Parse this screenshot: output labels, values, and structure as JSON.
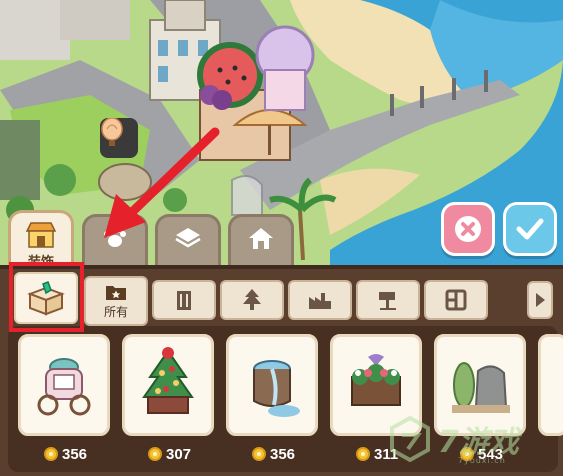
{
  "category_tabs": [
    {
      "label": "装饰",
      "icon": "shop-icon",
      "active": true
    },
    {
      "label": "",
      "icon": "pawprint-icon",
      "active": false
    },
    {
      "label": "",
      "icon": "stack-icon",
      "active": false
    },
    {
      "label": "",
      "icon": "house-icon",
      "active": false
    }
  ],
  "sub_tabs": [
    {
      "label": "",
      "icon": "gift-box-icon",
      "active": true
    },
    {
      "label": "所有",
      "icon": "star-folder-icon",
      "active": false
    },
    {
      "label": "",
      "icon": "building-icon",
      "active": false
    },
    {
      "label": "",
      "icon": "tree-icon",
      "active": false
    },
    {
      "label": "",
      "icon": "factory-icon",
      "active": false
    },
    {
      "label": "",
      "icon": "lamp-icon",
      "active": false
    },
    {
      "label": "",
      "icon": "grid-tile-icon",
      "active": false
    }
  ],
  "items": [
    {
      "name": "ornate carriage",
      "icon": "carriage-icon",
      "price": "356"
    },
    {
      "name": "decorated christmas tree",
      "icon": "christmas-tree-icon",
      "price": "307"
    },
    {
      "name": "stone fountain",
      "icon": "fountain-icon",
      "price": "356"
    },
    {
      "name": "flower planter",
      "icon": "flower-planter-icon",
      "price": "311"
    },
    {
      "name": "hedge rock garden",
      "icon": "hedge-rock-icon",
      "price": "543"
    }
  ],
  "actions": {
    "cancel_icon": "close-icon",
    "confirm_icon": "check-icon"
  },
  "watermark": {
    "text": "7游戏",
    "url": "7youxi.cn"
  },
  "colors": {
    "panel": "#5b3f2e",
    "cancel": "#f08aa0",
    "confirm": "#6cc8e8",
    "highlight": "#e5212c",
    "coin": "#f7c332"
  }
}
